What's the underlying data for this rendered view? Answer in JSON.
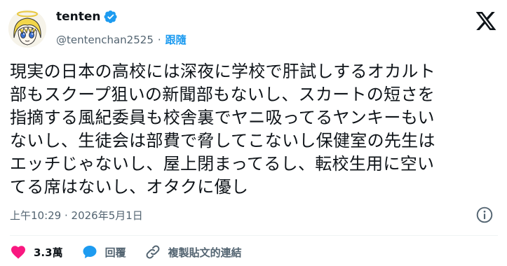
{
  "author": {
    "display_name": "tenten",
    "handle": "@tentenchan2525",
    "separator": "·",
    "follow_label": "跟隨"
  },
  "tweet": {
    "text": "現実の日本の高校には深夜に学校で肝試しするオカルト\n部もスクープ狙いの新聞部もないし、スカートの短さを\n指摘する風紀委員も校舎裏でヤニ吸ってるヤンキーもい\nないし、生徒会は部費で脅してこないし保健室の先生は\nエッチじゃないし、屋上閉まってるし、転校生用に空い\nてる席はないし、オタクに優し",
    "timestamp": "上午10:29 · 2026年5月1日"
  },
  "actions": {
    "like_count": "3.3萬",
    "reply_label": "回覆",
    "copy_link_label": "複製貼文的連結"
  },
  "icons": {
    "verified": "verified-badge-icon",
    "logo": "x-logo-icon",
    "info": "info-icon",
    "like": "heart-icon",
    "reply": "speech-bubble-icon",
    "link": "link-icon"
  },
  "colors": {
    "text": "#0f1419",
    "secondary": "#536471",
    "accent": "#1d9bf0",
    "like": "#f91880"
  }
}
